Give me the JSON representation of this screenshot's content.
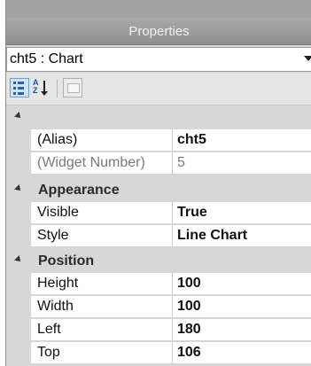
{
  "window": {
    "title": "Properties"
  },
  "object_selector": {
    "value": "cht5 : Chart"
  },
  "toolbar": {
    "categorized_icon": "categorized-icon",
    "alphabetical_icon": "alphabetical-sort-icon",
    "property_pages_icon": "property-pages-icon"
  },
  "categories": [
    {
      "label": "",
      "properties": [
        {
          "name": "(Alias)",
          "value": "cht5",
          "readonly": false
        },
        {
          "name": "(Widget Number)",
          "value": "5",
          "readonly": true
        }
      ]
    },
    {
      "label": "Appearance",
      "properties": [
        {
          "name": "Visible",
          "value": "True",
          "readonly": false
        },
        {
          "name": "Style",
          "value": "Line Chart",
          "readonly": false
        }
      ]
    },
    {
      "label": "Position",
      "properties": [
        {
          "name": "Height",
          "value": "100",
          "readonly": false
        },
        {
          "name": "Width",
          "value": "100",
          "readonly": false
        },
        {
          "name": "Left",
          "value": "180",
          "readonly": false
        },
        {
          "name": "Top",
          "value": "106",
          "readonly": false
        }
      ]
    }
  ],
  "colors": {
    "title_bar": "#9c9c9c",
    "panel_background": "#d7d7d7",
    "selected_tool": "#cfe3f8"
  }
}
